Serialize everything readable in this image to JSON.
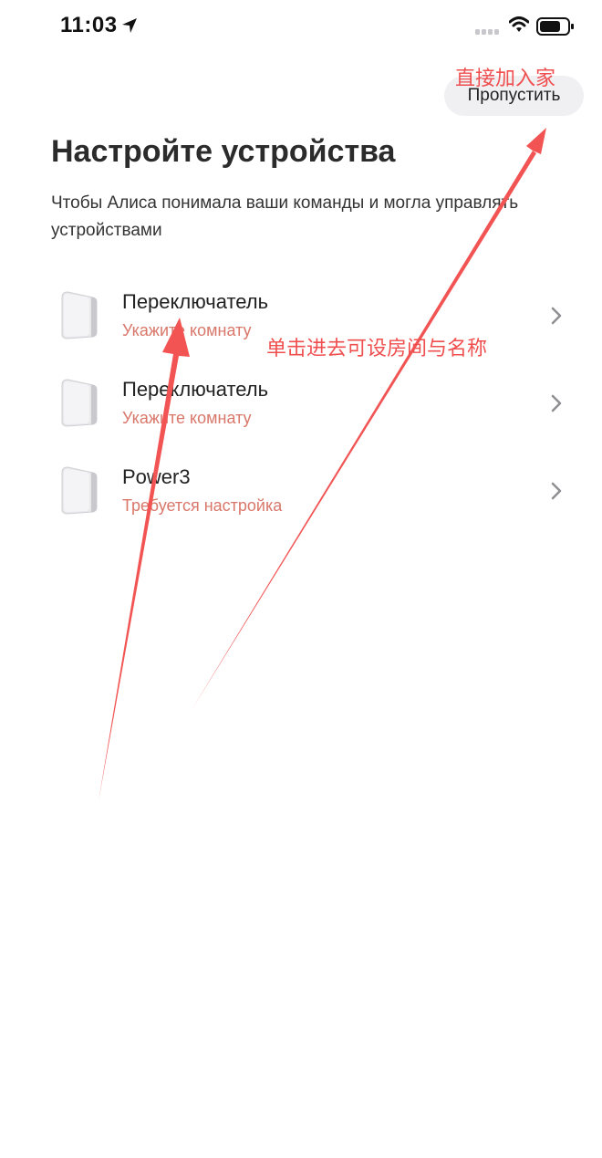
{
  "status_bar": {
    "time": "11:03"
  },
  "header": {
    "skip_label": "Пропустить"
  },
  "main": {
    "title": "Настройте устройства",
    "subtitle": "Чтобы Алиса понимала ваши команды и могла управлять устройствами"
  },
  "devices": [
    {
      "name": "Переключатель",
      "status": "Укажите комнату"
    },
    {
      "name": "Переключатель",
      "status": "Укажите комнату"
    },
    {
      "name": "Power3",
      "status": "Требуется настройка"
    }
  ],
  "annotations": {
    "skip_note": "直接加入家",
    "click_note": "单击进去可设房间与名称"
  },
  "colors": {
    "status_text": "#d9776a",
    "annotation": "#f04f4f",
    "skip_bg": "#f0f0f3"
  }
}
